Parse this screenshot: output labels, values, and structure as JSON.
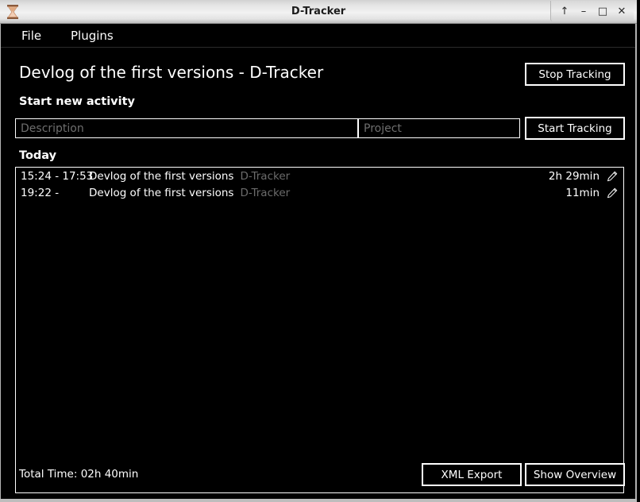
{
  "window": {
    "title": "D-Tracker",
    "app_icon": "hourglass-icon",
    "controls": {
      "shade": "↑",
      "minimize": "–",
      "maximize": "□",
      "close": "✕"
    }
  },
  "menubar": {
    "items": [
      {
        "label": "File"
      },
      {
        "label": "Plugins"
      }
    ]
  },
  "header": {
    "page_title": "Devlog of the first versions - D-Tracker",
    "stop_tracking_label": "Stop Tracking"
  },
  "start_activity": {
    "section_label": "Start new activity",
    "description_value": "",
    "description_placeholder": "Description",
    "project_value": "",
    "project_placeholder": "Project",
    "start_tracking_label": "Start Tracking"
  },
  "today": {
    "section_label": "Today",
    "entries": [
      {
        "time": "15:24 - 17:53",
        "description": "Devlog of the first versions",
        "project": "D-Tracker",
        "duration": "2h 29min",
        "edit_icon": "pencil-icon"
      },
      {
        "time": "19:22 -",
        "description": "Devlog of the first versions",
        "project": "D-Tracker",
        "duration": "11min",
        "edit_icon": "pencil-icon"
      }
    ]
  },
  "footer": {
    "total_time": "Total Time: 02h 40min",
    "xml_export_label": "XML Export",
    "show_overview_label": "Show Overview"
  },
  "colors": {
    "background": "#000000",
    "foreground": "#ffffff",
    "muted_text": "#6b6b6b",
    "titlebar_text": "#1c1c1c"
  }
}
